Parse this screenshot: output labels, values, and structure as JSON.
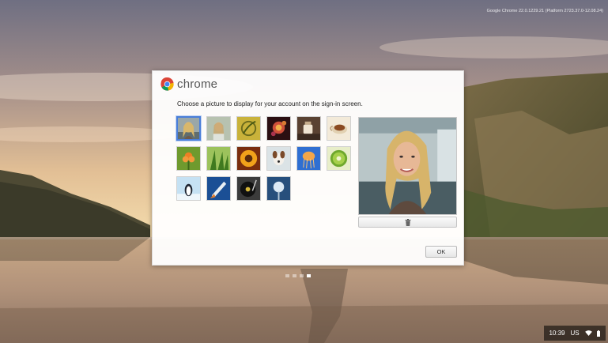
{
  "system": {
    "version_text": "Google Chrome 22.0.1229.21 (Platform 2723.37.0-12.08.24)"
  },
  "dialog": {
    "brand_name": "chrome",
    "instruction": "Choose a picture to display for your account on the sign-in screen.",
    "ok_label": "OK",
    "discard_icon": "trash-icon",
    "images": [
      {
        "name": "profile-photo",
        "selected": true
      },
      {
        "name": "woman-portrait"
      },
      {
        "name": "leaf-swirl"
      },
      {
        "name": "fireworks"
      },
      {
        "name": "coffee-cup"
      },
      {
        "name": "tea-cup"
      },
      {
        "name": "orange-flower"
      },
      {
        "name": "grass"
      },
      {
        "name": "sunflower"
      },
      {
        "name": "dog"
      },
      {
        "name": "jellyfish"
      },
      {
        "name": "kiwi"
      },
      {
        "name": "penguin"
      },
      {
        "name": "shuttle"
      },
      {
        "name": "turntable"
      },
      {
        "name": "dandelion"
      }
    ]
  },
  "pager": {
    "count": 4,
    "active": 3
  },
  "tray": {
    "time": "10:39",
    "locale": "US",
    "wifi_icon": "wifi-icon",
    "battery_icon": "battery-icon"
  },
  "colors": {
    "selection": "#4a7ed9",
    "dialog_bg": "#ffffff",
    "tray_bg": "#000000"
  }
}
